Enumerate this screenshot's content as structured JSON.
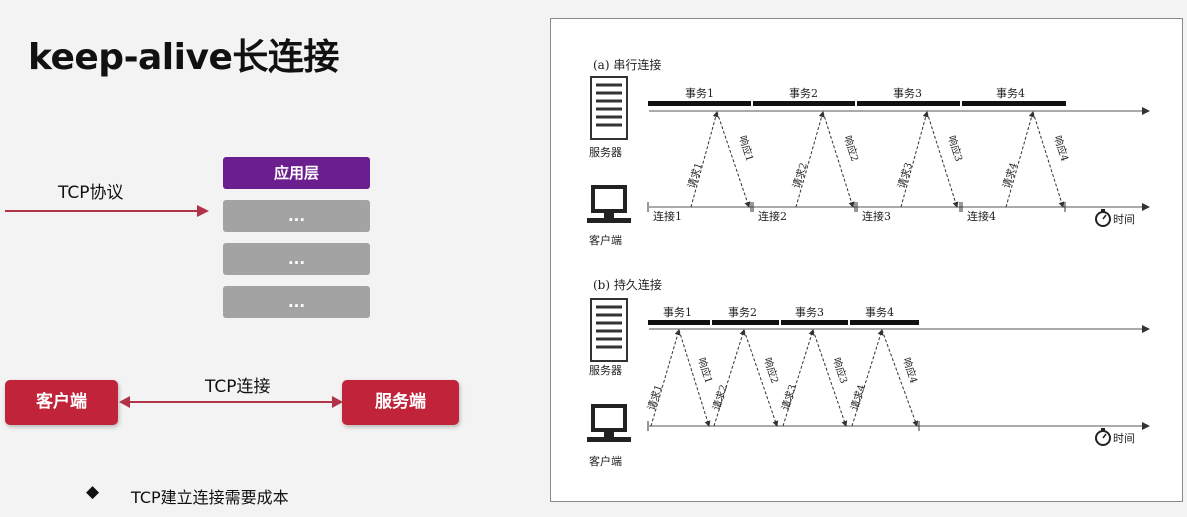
{
  "title": "keep-alive长连接",
  "left": {
    "tcp_label": "TCP协议",
    "layers": [
      "应用层",
      "...",
      "...",
      "..."
    ],
    "client": "客户端",
    "server": "服务端",
    "connection_label": "TCP连接",
    "bullet_text": "TCP建立连接需要成本"
  },
  "diagram_a": {
    "caption": "(a) 串行连接",
    "server": "服务器",
    "client": "客户端",
    "transactions": [
      "事务1",
      "事务2",
      "事务3",
      "事务4"
    ],
    "requests": [
      "请求1",
      "请求2",
      "请求3",
      "请求4"
    ],
    "responses": [
      "响应1",
      "响应2",
      "响应3",
      "响应4"
    ],
    "connections": [
      "连接1",
      "连接2",
      "连接3",
      "连接4"
    ],
    "time": "时间"
  },
  "diagram_b": {
    "caption": "(b) 持久连接",
    "server": "服务器",
    "client": "客户端",
    "transactions": [
      "事务1",
      "事务2",
      "事务3",
      "事务4"
    ],
    "requests": [
      "请求1",
      "请求2",
      "请求3",
      "请求4"
    ],
    "responses": [
      "响应1",
      "响应2",
      "响应3",
      "响应4"
    ],
    "time": "时间"
  }
}
